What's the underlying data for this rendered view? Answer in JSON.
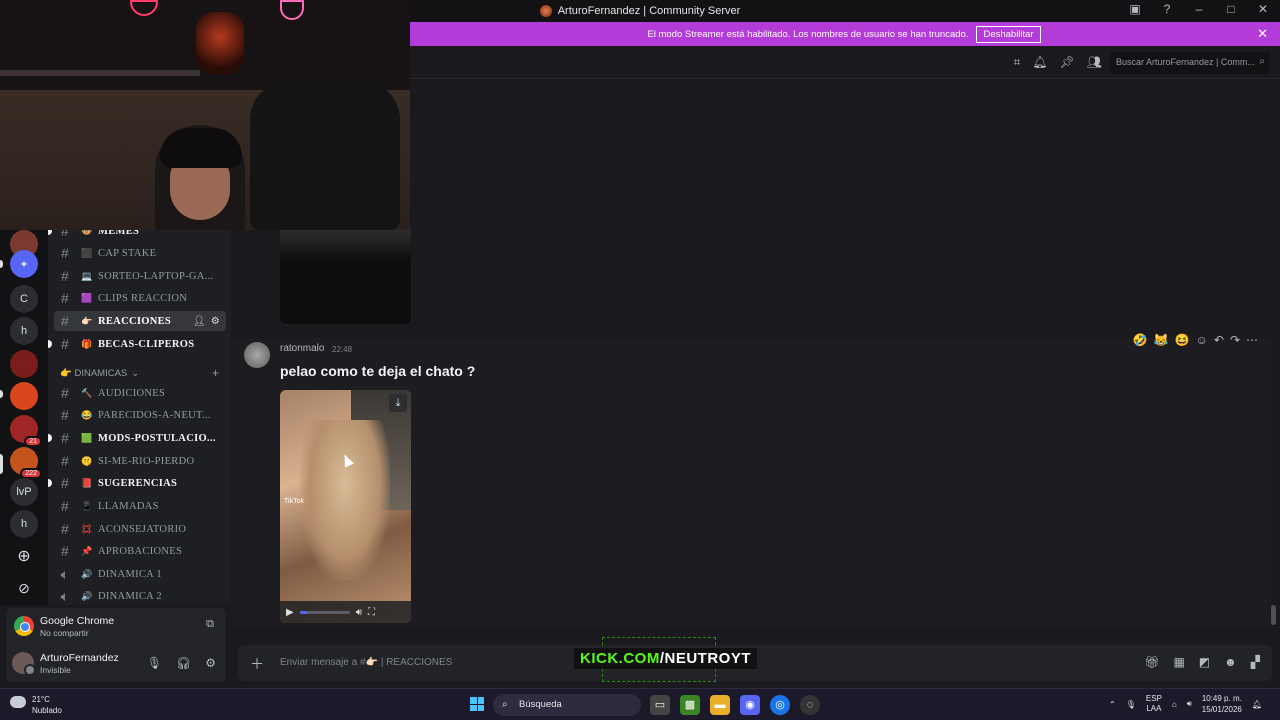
{
  "window": {
    "title": "ArturoFernandez | Community Server"
  },
  "banner": {
    "message": "El modo Streamer está habilitado. Los nombres de usuario se han truncado.",
    "button": "Deshabilitar",
    "close": "✕"
  },
  "header": {
    "search_placeholder": "Buscar ArturoFernandez | Comm..."
  },
  "rail": {
    "servers": [
      {
        "label": "C"
      },
      {
        "label": "h"
      },
      {
        "label": "lvP"
      },
      {
        "label": "h"
      }
    ],
    "badges": [
      "21",
      "222"
    ]
  },
  "channels": {
    "items": [
      {
        "name": "MEMES",
        "emoji": "🐵"
      },
      {
        "name": "CAP  STAKE",
        "emoji": "⬛"
      },
      {
        "name": "SORTEO-LAPTOP-GA...",
        "emoji": "💻"
      },
      {
        "name": "CLIPS  REACCION",
        "emoji": "🟪"
      },
      {
        "name": "REACCIONES",
        "emoji": "👉🏻"
      },
      {
        "name": "BECAS-CLIPEROS",
        "emoji": "🎁"
      }
    ],
    "category": "👉 DINAMICAS",
    "items2": [
      {
        "name": "AUDICIONES",
        "emoji": "🔨"
      },
      {
        "name": "PARECIDOS-A-NEUT...",
        "emoji": "😂"
      },
      {
        "name": "MODS-POSTULACIO...",
        "emoji": "🟩"
      },
      {
        "name": "SI-ME-RIO-PIERDO",
        "emoji": "🤫"
      },
      {
        "name": "SUGERENCIAS",
        "emoji": "📕"
      },
      {
        "name": "LLAMADAS",
        "emoji": "📱"
      },
      {
        "name": "ACONSEJATORIO",
        "emoji": "💢"
      },
      {
        "name": "APROBACIONES",
        "emoji": "📌"
      },
      {
        "name": "DINAMICA 1",
        "emoji": "🔊"
      },
      {
        "name": "DINAMICA 2",
        "emoji": "🔊"
      }
    ]
  },
  "activity": {
    "app": "Google Chrome",
    "status": "No compartir"
  },
  "user": {
    "name": "ArturoFernandez",
    "status": "Invisible"
  },
  "message": {
    "author": "ratonmalo",
    "time": "22:48",
    "text": "pelao como te deja el chato ?",
    "video_watermark": "TikTok",
    "video_progress": 0.15,
    "reactions": [
      "🤣",
      "😹",
      "😆"
    ]
  },
  "composer": {
    "placeholder": "Enviar mensaje a #👉🏻 | REACCIONES"
  },
  "overlay": {
    "kick_prefix": "KICK.COM",
    "kick_suffix": "/NEUTROYT"
  },
  "taskbar": {
    "temp": "21°C",
    "condition": "Nublado",
    "search": "Búsqueda",
    "lang1": "ESP",
    "lang2": "LAA",
    "time": "10:49 p. m.",
    "date": "15/01/2026"
  },
  "colors": {
    "banner": "#b33bd8",
    "accent": "#5865f2",
    "kick_green": "#53fc18"
  }
}
